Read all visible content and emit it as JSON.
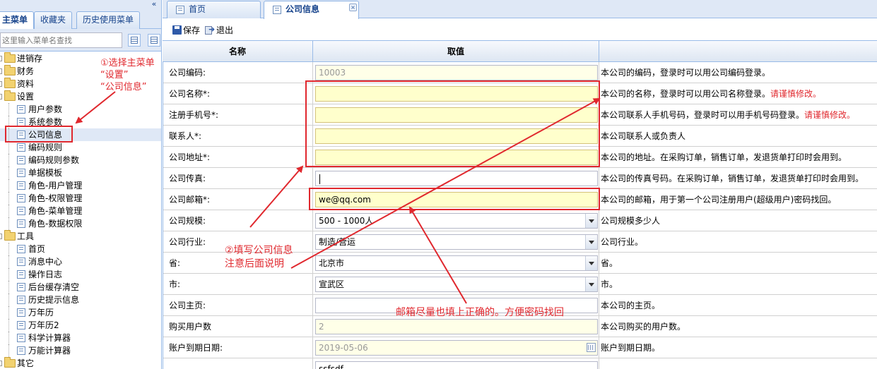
{
  "left": {
    "tabs": [
      {
        "label": "主菜单",
        "active": true
      },
      {
        "label": "收藏夹",
        "active": false
      },
      {
        "label": "历史使用菜单",
        "active": false
      }
    ],
    "collapse_glyph": "«",
    "search_placeholder": "这里输入菜单名查找",
    "tree": [
      {
        "label": "进销存",
        "type": "folder"
      },
      {
        "label": "财务",
        "type": "folder"
      },
      {
        "label": "资料",
        "type": "folder"
      },
      {
        "label": "设置",
        "type": "folder"
      },
      {
        "label": "用户参数",
        "type": "leaf"
      },
      {
        "label": "系统参数",
        "type": "leaf"
      },
      {
        "label": "公司信息",
        "type": "leaf",
        "selected": true
      },
      {
        "label": "编码规则",
        "type": "leaf"
      },
      {
        "label": "编码规则参数",
        "type": "leaf"
      },
      {
        "label": "单据模板",
        "type": "leaf"
      },
      {
        "label": "角色-用户管理",
        "type": "leaf"
      },
      {
        "label": "角色-权限管理",
        "type": "leaf"
      },
      {
        "label": "角色-菜单管理",
        "type": "leaf"
      },
      {
        "label": "角色-数据权限",
        "type": "leaf"
      },
      {
        "label": "工具",
        "type": "folder"
      },
      {
        "label": "首页",
        "type": "leaf"
      },
      {
        "label": "消息中心",
        "type": "leaf"
      },
      {
        "label": "操作日志",
        "type": "leaf"
      },
      {
        "label": "后台缓存清空",
        "type": "leaf"
      },
      {
        "label": "历史提示信息",
        "type": "leaf"
      },
      {
        "label": "万年历",
        "type": "leaf"
      },
      {
        "label": "万年历2",
        "type": "leaf"
      },
      {
        "label": "科学计算器",
        "type": "leaf"
      },
      {
        "label": "万能计算器",
        "type": "leaf"
      },
      {
        "label": "其它",
        "type": "folder"
      }
    ]
  },
  "right": {
    "tabs": [
      {
        "label": "首页",
        "active": false
      },
      {
        "label": "公司信息",
        "active": true,
        "close_glyph": "×"
      }
    ],
    "toolbar": {
      "save_label": "保存",
      "exit_label": "退出"
    },
    "grid_headers": [
      "名称",
      "取值",
      ""
    ],
    "rows": [
      {
        "name": "公司编码:",
        "value": "10003",
        "kind": "disabled",
        "desc": "本公司的编码，登录时可以用公司编码登录。",
        "warn": ""
      },
      {
        "name": "公司名称*:",
        "value": "",
        "kind": "req",
        "desc": "本公司的名称，登录时可以用公司名称登录。",
        "warn": "请谨慎修改。"
      },
      {
        "name": "注册手机号*:",
        "value": "",
        "kind": "req",
        "desc": "本公司联系人手机号码，登录时可以用手机号码登录。",
        "warn": "请谨慎修改。"
      },
      {
        "name": "联系人*:",
        "value": "",
        "kind": "req",
        "desc": "本公司联系人或负责人",
        "warn": ""
      },
      {
        "name": "公司地址*:",
        "value": "",
        "kind": "req",
        "desc": "本公司的地址。在采购订单，销售订单，发退货单打印时会用到。",
        "warn": ""
      },
      {
        "name": "公司传真:",
        "value": "",
        "kind": "focus",
        "desc": "本公司的传真号码。在采购订单，销售订单，发退货单打印时会用到。",
        "warn": ""
      },
      {
        "name": "公司邮箱*:",
        "value": "we@qq.com",
        "kind": "req",
        "desc": "本公司的邮箱，用于第一个公司注册用户(超级用户)密码找回。",
        "warn": ""
      },
      {
        "name": "公司规模:",
        "value": "500 - 1000人",
        "kind": "select",
        "desc": "公司规模多少人",
        "warn": ""
      },
      {
        "name": "公司行业:",
        "value": "制造/营运",
        "kind": "select",
        "desc": "公司行业。",
        "warn": ""
      },
      {
        "name": "省:",
        "value": "北京市",
        "kind": "select",
        "desc": "省。",
        "warn": ""
      },
      {
        "name": "市:",
        "value": "宣武区",
        "kind": "select",
        "desc": "市。",
        "warn": ""
      },
      {
        "name": "公司主页:",
        "value": "",
        "kind": "plain",
        "desc": "本公司的主页。",
        "warn": ""
      },
      {
        "name": "购买用户数",
        "value": "2",
        "kind": "disabled",
        "desc": "本公司购买的用户数。",
        "warn": ""
      },
      {
        "name": "账户到期日期:",
        "value": "2019-05-06",
        "kind": "date",
        "desc": "账户到期日期。",
        "warn": ""
      },
      {
        "name": "",
        "value": "ssfsdf",
        "kind": "plain",
        "desc": "",
        "warn": ""
      }
    ]
  },
  "annotations": {
    "step1_line1": "①选择主菜单",
    "step1_line2": "“设置”",
    "step1_line3": "“公司信息”",
    "step2_line1": "②填写公司信息",
    "step2_line2": "注意后面说明",
    "email_note": "邮箱尽量也填上正确的。方便密码找回",
    "color": "#e0282e"
  }
}
